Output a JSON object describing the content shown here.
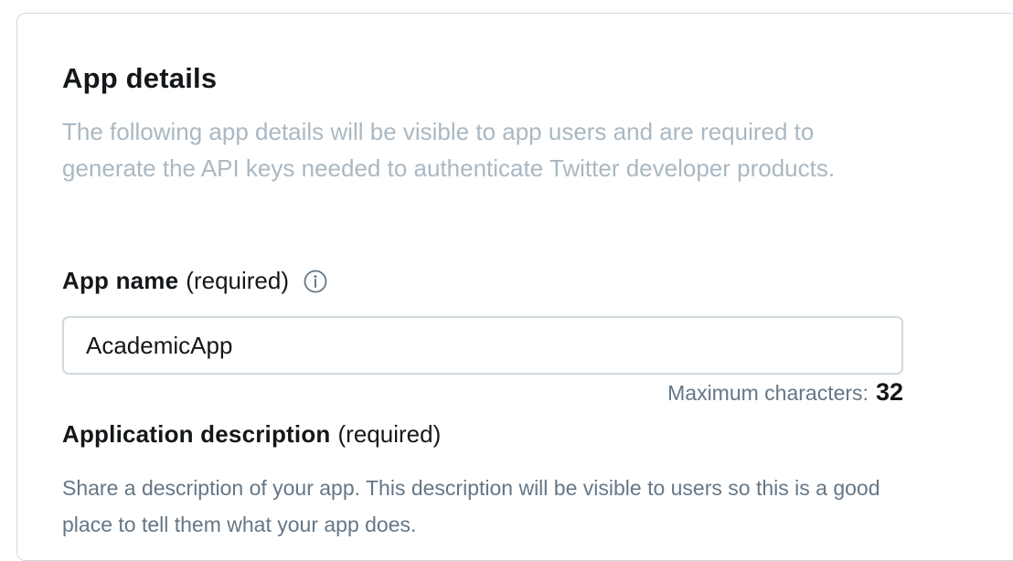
{
  "section": {
    "title": "App details",
    "description": "The following app details will be visible to app users and are required to generate the API keys needed to authenticate Twitter developer products."
  },
  "app_name_field": {
    "label": "App name",
    "required_suffix": "(required)",
    "info_icon": "info-circle-icon",
    "value": "AcademicApp",
    "max_chars_label": "Maximum characters:",
    "max_chars_value": "32"
  },
  "description_field": {
    "label": "Application description",
    "required_suffix": "(required)",
    "help_text": "Share a description of your app. This description will be visible to users so this is a good place to tell them what your app does."
  },
  "colors": {
    "border": "#cfd9de",
    "muted_text": "#aab8c2",
    "secondary_text": "#657786",
    "primary_text": "#14171a"
  }
}
